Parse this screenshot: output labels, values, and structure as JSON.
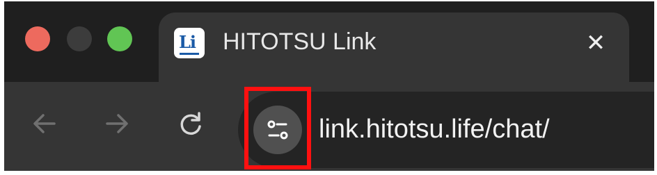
{
  "window_controls": {
    "close": "close-button",
    "minimize": "minimize-button",
    "maximize": "maximize-button"
  },
  "tab": {
    "favicon_text": "Li",
    "title": "HITOTSU Link",
    "close_glyph": "✕"
  },
  "toolbar": {
    "back_icon": "arrow-left-icon",
    "forward_icon": "arrow-right-icon",
    "reload_icon": "reload-icon"
  },
  "omnibox": {
    "site_info_icon": "tune-icon",
    "url": "link.hitotsu.life/chat/"
  },
  "colors": {
    "window_bg": "#1f1f1f",
    "tab_bg": "#353535",
    "omnibox_bg": "#242424",
    "traffic_close": "#ed6a5e",
    "traffic_max": "#61c554",
    "highlight": "#ff1010"
  }
}
